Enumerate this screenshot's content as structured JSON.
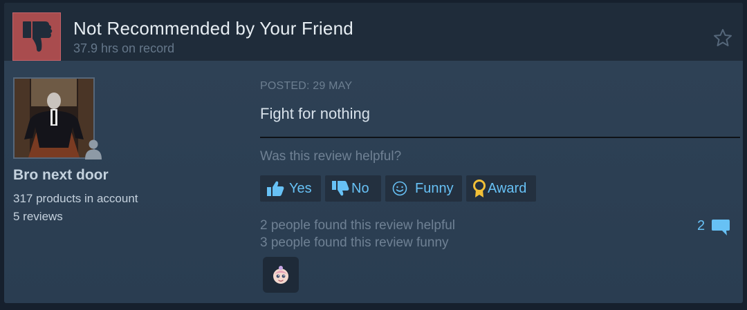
{
  "header": {
    "title": "Not Recommended by Your Friend",
    "hours": "37.9 hrs on record",
    "thumb_icon": "thumbs-down-icon",
    "star_icon": "star-outline-icon"
  },
  "author": {
    "name": "Bro next door",
    "products": "317 products in account",
    "reviews": "5 reviews",
    "status_icon": "person-icon"
  },
  "review": {
    "posted": "POSTED: 29 MAY",
    "text": "Fight for nothing",
    "helpful_question": "Was this review helpful?"
  },
  "vote_buttons": {
    "yes": "Yes",
    "no": "No",
    "funny": "Funny",
    "award": "Award"
  },
  "stats": {
    "helpful": "2 people found this review helpful",
    "funny": "3 people found this review funny",
    "comments": "2"
  },
  "colors": {
    "accent": "#67c1f5",
    "negative": "#a94c4e",
    "award_gold": "#f2c037"
  }
}
